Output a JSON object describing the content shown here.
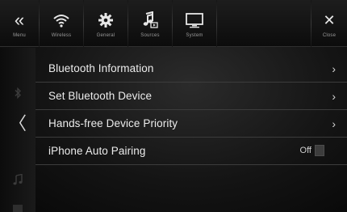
{
  "topbar": {
    "menu_label": "Menu",
    "tabs": [
      {
        "label": "Wireless",
        "icon": "wifi-icon"
      },
      {
        "label": "General",
        "icon": "gear-icon"
      },
      {
        "label": "Sources",
        "icon": "music-note-icon"
      },
      {
        "label": "System",
        "icon": "monitor-icon"
      }
    ],
    "close_label": "Close"
  },
  "icons": {
    "menu": "«",
    "close": "✕",
    "back": "〈",
    "chevron": "›"
  },
  "list": {
    "items": [
      {
        "label": "Bluetooth Information"
      },
      {
        "label": "Set Bluetooth Device"
      },
      {
        "label": "Hands-free Device Priority"
      },
      {
        "label": "iPhone Auto Pairing",
        "value": "Off"
      }
    ]
  },
  "colors": {
    "text": "#ececec",
    "divider": "#3c3c3c",
    "background": "#141414"
  }
}
